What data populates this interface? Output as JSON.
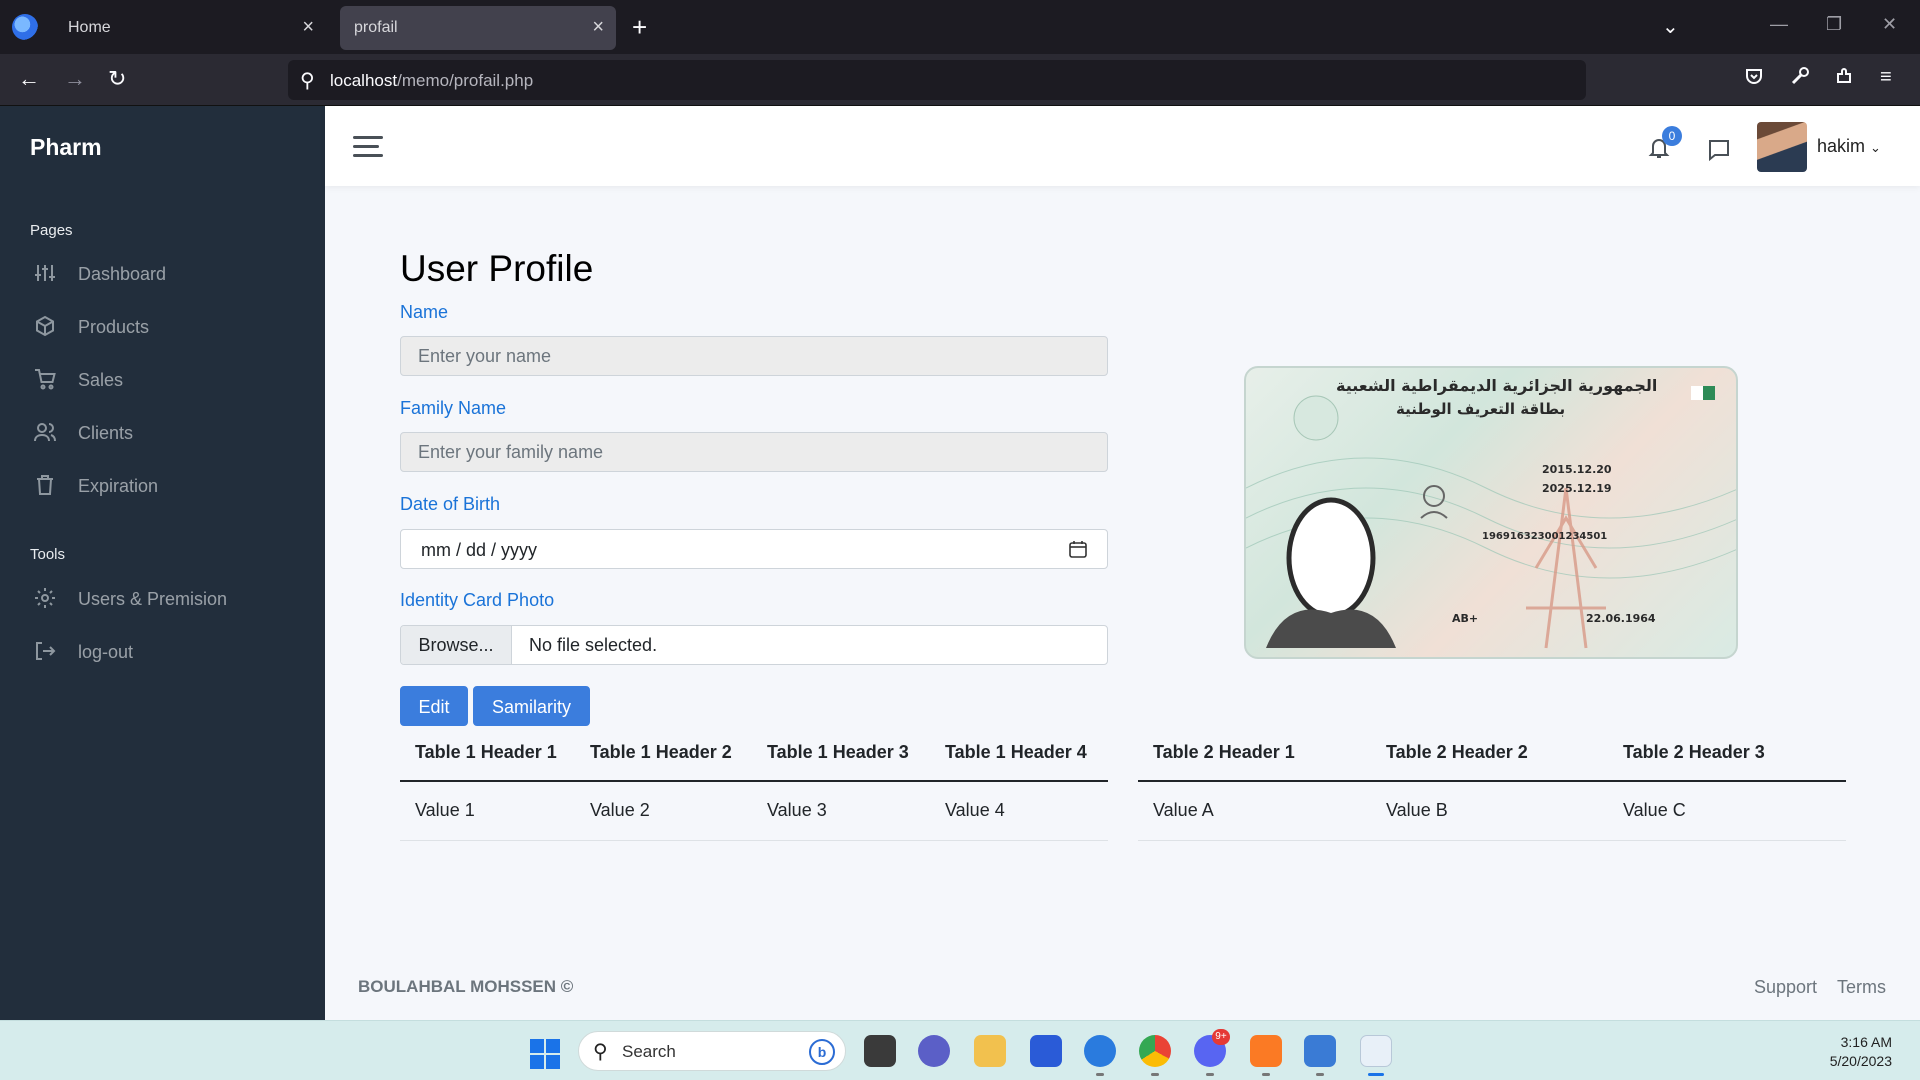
{
  "browser": {
    "tabs": [
      {
        "label": "Home"
      },
      {
        "label": "profail"
      }
    ],
    "url_host": "localhost",
    "url_path": "/memo/profail.php"
  },
  "sidebar": {
    "brand": "Pharm",
    "sections": [
      {
        "title": "Pages",
        "items": [
          {
            "label": "Dashboard",
            "icon": "sliders-icon"
          },
          {
            "label": "Products",
            "icon": "package-icon"
          },
          {
            "label": "Sales",
            "icon": "cart-icon"
          },
          {
            "label": "Clients",
            "icon": "users-icon"
          },
          {
            "label": "Expiration",
            "icon": "trash-icon"
          }
        ]
      },
      {
        "title": "Tools",
        "items": [
          {
            "label": "Users & Premision",
            "icon": "gear-icon"
          },
          {
            "label": "log-out",
            "icon": "logout-icon"
          }
        ]
      }
    ]
  },
  "header": {
    "notification_count": "0",
    "username": "hakim",
    "accent": "#3b7ddd"
  },
  "form": {
    "title": "User Profile",
    "name_label": "Name",
    "name_placeholder": "Enter your name",
    "family_label": "Family Name",
    "family_placeholder": "Enter your family name",
    "dob_label": "Date of Birth",
    "dob_value": "mm / dd / yyyy",
    "photo_label": "Identity Card Photo",
    "browse_label": "Browse...",
    "file_status": "No file selected.",
    "edit_label": "Edit",
    "similarity_label": "Samilarity"
  },
  "id_card": {
    "header_line1": "الجمهورية الجزائرية الديمقراطية الشعبية",
    "header_line2": "بطاقة التعريف الوطنية",
    "issue_date": "2015.12.20",
    "expiry_date": "2025.12.19",
    "nin": "196916323001234501",
    "blood_type": "AB+",
    "birth_date": "22.06.1964"
  },
  "table1": {
    "headers": [
      "Table 1 Header 1",
      "Table 1 Header 2",
      "Table 1 Header 3",
      "Table 1 Header 4"
    ],
    "rows": [
      [
        "Value 1",
        "Value 2",
        "Value 3",
        "Value 4"
      ]
    ]
  },
  "table2": {
    "headers": [
      "Table 2 Header 1",
      "Table 2 Header 2",
      "Table 2 Header 3"
    ],
    "rows": [
      [
        "Value A",
        "Value B",
        "Value C"
      ]
    ]
  },
  "footer": {
    "copyright": "BOULAHBAL MOHSSEN ©",
    "support": "Support",
    "terms": "Terms"
  },
  "taskbar": {
    "search_label": "Search",
    "time": "3:16 AM",
    "date": "5/20/2023",
    "discord_badge": "9+"
  }
}
